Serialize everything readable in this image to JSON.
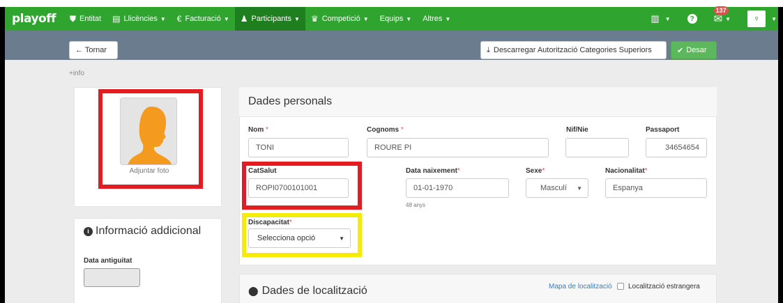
{
  "navbar": {
    "logo": "playoff",
    "items": [
      {
        "label": "Entitat",
        "icon": "shield-icon",
        "glyph": "⛊"
      },
      {
        "label": "Llicències",
        "icon": "card-icon",
        "glyph": "▤"
      },
      {
        "label": "Facturació",
        "icon": "euro-icon",
        "glyph": "€"
      },
      {
        "label": "Participants",
        "icon": "user-icon",
        "glyph": "👤"
      },
      {
        "label": "Competició",
        "icon": "trophy-icon",
        "glyph": "🏆"
      },
      {
        "label": "Equips",
        "icon": "",
        "glyph": ""
      },
      {
        "label": "Altres",
        "icon": "",
        "glyph": ""
      }
    ],
    "notification_count": "137",
    "colors": {
      "bar": "#2fa52f",
      "active": "#1f7f1f"
    }
  },
  "toolbar": {
    "back_label": "← Tornar",
    "download_label": "Descarregar Autorització Categories Superiors",
    "save_label": "Desar"
  },
  "more_info": "+info",
  "photo": {
    "caption": "Adjuntar foto"
  },
  "additional_info": {
    "title": "Informació addicional",
    "date_label": "Data antiguitat",
    "date_value": ""
  },
  "personal": {
    "title": "Dades personals",
    "fields": {
      "nom": {
        "label": "Nom",
        "value": "TONI"
      },
      "cognoms": {
        "label": "Cognoms",
        "value": "ROURE PI"
      },
      "nif": {
        "label": "Nif/Nie",
        "value": ""
      },
      "passaport": {
        "label": "Passaport",
        "value": "34654654"
      },
      "catsalut": {
        "label": "CatSalut",
        "value": "ROPI0700101001"
      },
      "naixement": {
        "label": "Data naixement",
        "value": "01-01-1970",
        "helper": "48 anys"
      },
      "sexe": {
        "label": "Sexe",
        "value": "Masculí"
      },
      "nacionalitat": {
        "label": "Nacionalitat",
        "value": "Espanya"
      },
      "discapacitat": {
        "label": "Discapacitat",
        "value": "Selecciona opció"
      }
    }
  },
  "location": {
    "title": "Dades de localització",
    "map_link": "Mapa de localització",
    "foreign_label": "Localització estrangera"
  }
}
